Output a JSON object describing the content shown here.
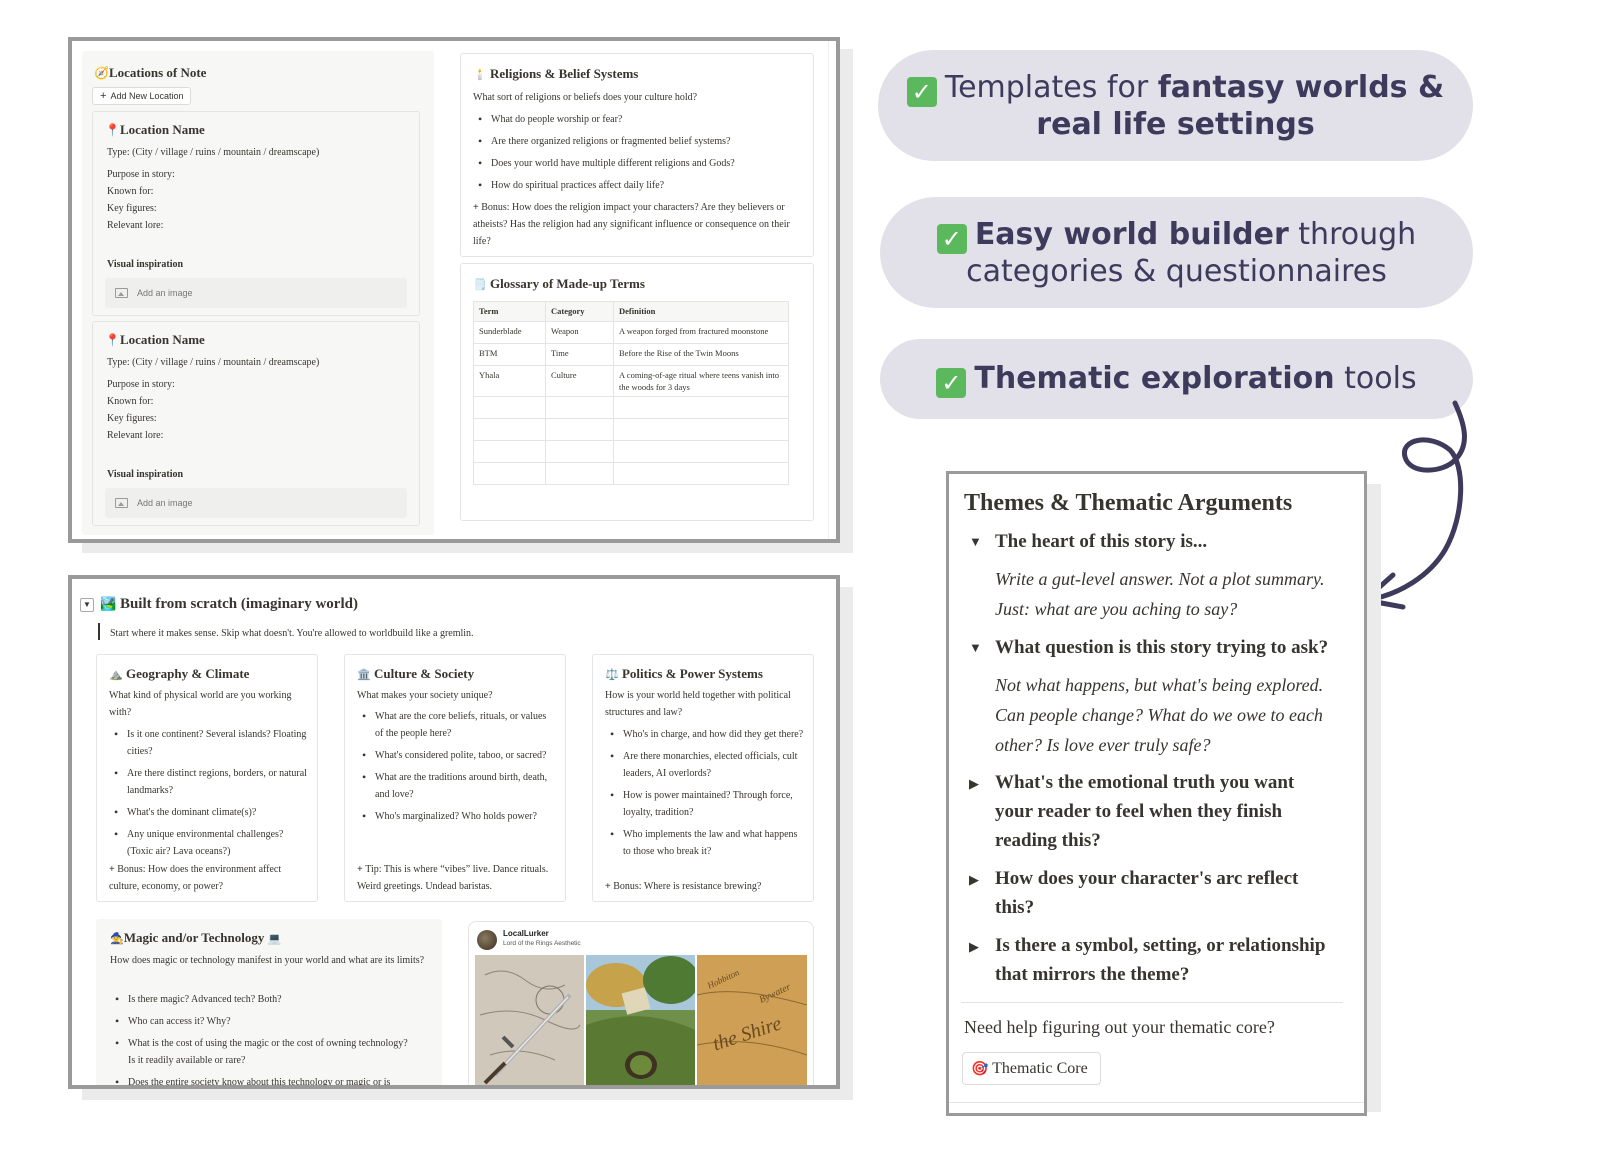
{
  "locations": {
    "title": "Locations of Note",
    "add_button": "Add New Location",
    "cards": [
      {
        "name": "Location Name",
        "type": "Type: (City / village / ruins / mountain / dreamscape)",
        "fields": [
          "Purpose in story:",
          "Known for:",
          "Key figures:",
          "Relevant lore:"
        ],
        "visual_label": "Visual inspiration",
        "image_placeholder": "Add an image"
      },
      {
        "name": "Location Name",
        "type": "Type: (City / village / ruins / mountain / dreamscape)",
        "fields": [
          "Purpose in story:",
          "Known for:",
          "Key figures:",
          "Relevant lore:"
        ],
        "visual_label": "Visual inspiration",
        "image_placeholder": "Add an image"
      }
    ]
  },
  "religions": {
    "title": "Religions & Belief Systems",
    "intro": "What sort of religions or beliefs does your culture hold?",
    "bullets": [
      "What do people worship or fear?",
      "Are there organized religions or fragmented belief systems?",
      "Does your world have multiple different religions and Gods?",
      "How do spiritual practices affect daily life?"
    ],
    "bonus": "Bonus: How does the religion impact your characters? Are they believers or atheists? Has the religion had any significant influence or consequence on their life?"
  },
  "glossary": {
    "title": "Glossary of Made-up Terms",
    "headers": [
      "Term",
      "Category",
      "Definition"
    ],
    "rows": [
      [
        "Sunderblade",
        "Weapon",
        "A weapon forged from fractured moonstone"
      ],
      [
        "BTM",
        "Time",
        "Before the Rise of the Twin Moons"
      ],
      [
        "Yhala",
        "Culture",
        "A coming-of-age ritual where teens vanish into the woods for 3 days"
      ]
    ]
  },
  "scratch": {
    "title": "Built from scratch (imaginary world)",
    "quote": "Start where it makes sense. Skip what doesn't. You're allowed to worldbuild like a gremlin.",
    "geo": {
      "title": "Geography & Climate",
      "intro": "What kind of physical world are you working with?",
      "bullets": [
        "Is it one continent? Several islands? Floating cities?",
        "Are there distinct regions, borders, or natural landmarks?",
        "What's the dominant climate(s)?",
        "Any unique environmental challenges? (Toxic air? Lava oceans?)"
      ],
      "bonus": "Bonus: How does the environment affect culture, economy, or power?"
    },
    "culture": {
      "title": "Culture & Society",
      "intro": "What makes your society unique?",
      "bullets": [
        "What are the core beliefs, rituals, or values of the people here?",
        "What's considered polite, taboo, or sacred?",
        "What are the traditions around birth, death, and love?",
        "Who's marginalized? Who holds power?"
      ],
      "bonus": "Tip: This is where “vibes” live. Dance rituals. Weird greetings. Undead baristas."
    },
    "politics": {
      "title": "Politics & Power Systems",
      "intro": "How is your world held together with political structures and law?",
      "bullets": [
        "Who's in charge, and how did they get there?",
        "Are there monarchies, elected officials, cult leaders, AI overlords?",
        "How is power maintained? Through force, loyalty, tradition?",
        "Who implements the law and what happens to those who break it?"
      ],
      "bonus": "Bonus: Where is resistance brewing?"
    },
    "magic": {
      "title": "Magic and/or Technology",
      "intro": "How does magic or technology manifest in your world and what are its limits?",
      "bullets": [
        "Is there magic? Advanced tech? Both?",
        "Who can access it? Why?",
        "What is the cost of using the magic or the cost of owning technology? Is it readily available or rare?",
        "Does the entire society know about this technology or magic or is"
      ]
    },
    "pin": {
      "user": "LocalLurker",
      "board": "Lord of the Rings Aesthetic"
    }
  },
  "pills": [
    {
      "pre": "Templates for ",
      "bold": "fantasy worlds & real life settings",
      "post": ""
    },
    {
      "pre": "",
      "bold": "Easy world builder",
      "post": " through categories & questionnaires"
    },
    {
      "pre": "",
      "bold": "Thematic exploration",
      "post": " tools"
    }
  ],
  "themes": {
    "title": "Themes & Thematic Arguments",
    "items": [
      {
        "q": "The heart of this story is...",
        "a": "Write a gut-level answer. Not a plot summary. Just: what are you aching to say?",
        "open": true
      },
      {
        "q": "What question is this story trying to ask?",
        "a": "Not what happens, but what's being explored. Can people change? What do we owe to each other? Is love ever truly safe?",
        "open": true
      },
      {
        "q": "What's the emotional truth you want your reader to feel when they finish reading this?",
        "open": false
      },
      {
        "q": "How does your character's arc reflect this?",
        "open": false
      },
      {
        "q": "Is there a symbol, setting, or relationship that mirrors the theme?",
        "open": false
      }
    ],
    "help": "Need help figuring out your thematic core?",
    "button": "Thematic Core"
  },
  "colors": {
    "pill_bg": "#e2e1ea",
    "pill_text": "#3e3a5c",
    "check_green": "#5cb85c",
    "arrow": "#3e3a5c",
    "frame": "#9a9a9a"
  }
}
